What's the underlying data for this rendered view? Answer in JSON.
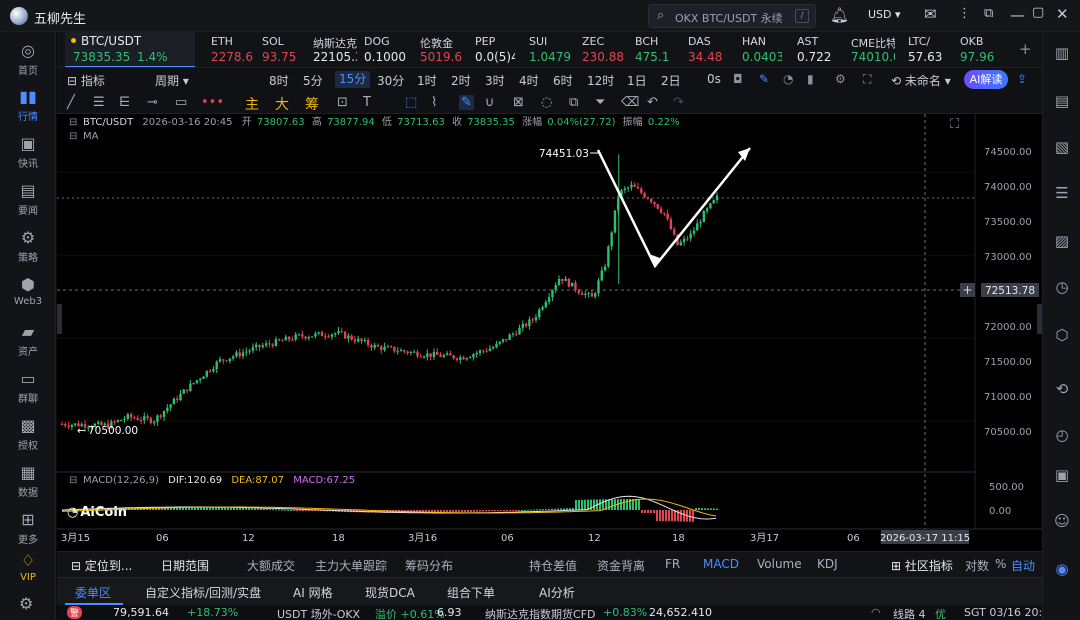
{
  "app": {
    "title": "五柳先生"
  },
  "search": {
    "placeholder": "OKX BTC/USDT 永续",
    "shortcut": "/"
  },
  "header": {
    "currency": "USD"
  },
  "sidebar": {
    "items": [
      {
        "label": "首页",
        "icon": "home-icon"
      },
      {
        "label": "行情",
        "icon": "chart-bars-icon"
      },
      {
        "label": "快讯",
        "icon": "flash-icon"
      },
      {
        "label": "要闻",
        "icon": "news-icon"
      },
      {
        "label": "策略",
        "icon": "robot-icon"
      },
      {
        "label": "Web3",
        "icon": "web3-icon"
      },
      {
        "label": "资产",
        "icon": "wallet-icon"
      },
      {
        "label": "群聊",
        "icon": "chat-icon"
      },
      {
        "label": "授权",
        "icon": "key-icon"
      },
      {
        "label": "数据",
        "icon": "data-icon"
      },
      {
        "label": "更多",
        "icon": "grid-icon"
      },
      {
        "label": "VIP",
        "icon": "vip-icon"
      }
    ]
  },
  "ticker": {
    "active": {
      "name": "BTC/USDT",
      "price": "73835.35",
      "change": "1.4%"
    },
    "items": [
      {
        "name": "ETH",
        "price": "2278.6"
      },
      {
        "name": "SOL",
        "price": "93.75"
      },
      {
        "name": "纳斯达克",
        "price": "22105.3"
      },
      {
        "name": "DOG",
        "price": "0.1000"
      },
      {
        "name": "伦敦金",
        "price": "5019.6"
      },
      {
        "name": "PEP",
        "price": "0.0(5)4"
      },
      {
        "name": "SUI",
        "price": "1.0479"
      },
      {
        "name": "ZEC",
        "price": "230.88"
      },
      {
        "name": "BCH",
        "price": "475.1"
      },
      {
        "name": "DAS",
        "price": "34.48"
      },
      {
        "name": "HAN",
        "price": "0.0403"
      },
      {
        "name": "AST",
        "price": "0.722"
      },
      {
        "name": "CME比特",
        "price": "74010.0"
      },
      {
        "name": "LTC/",
        "price": "57.63"
      },
      {
        "name": "OKB",
        "price": "97.96"
      }
    ]
  },
  "periodbar": {
    "indicator": "指标",
    "period": "周期",
    "periods": [
      "8时",
      "5分",
      "15分",
      "30分",
      "1时",
      "2时",
      "3时",
      "4时",
      "6时",
      "12时",
      "1日",
      "2日"
    ],
    "selected": "15分",
    "countdown": "0s",
    "layout_name": "未命名",
    "ai_button": "AI解读"
  },
  "drawbar": {
    "chips": [
      "主",
      "大",
      "筹"
    ]
  },
  "chart": {
    "info": {
      "symbol": "BTC/USDT",
      "datetime": "2026-03-16 20:45",
      "open_label": "开",
      "open": "73807.63",
      "high_label": "高",
      "high": "73877.94",
      "low_label": "低",
      "low": "73713.63",
      "close_label": "收",
      "close": "73835.35",
      "change_label": "涨幅",
      "change": "0.04%(27.72)",
      "amp_label": "振幅",
      "amp": "0.22%"
    },
    "ma_label": "MA",
    "macd": {
      "label": "MACD(12,26,9)",
      "dif": "DIF:120.69",
      "dea": "DEA:87.07",
      "macd": "MACD:67.25"
    },
    "high_marker": "74451.03",
    "low_marker": "70500.00",
    "crosshair_price": "72513.78",
    "crosshair_time": "2026-03-17 11:15",
    "watermark": "AiCoin",
    "price_ticks": [
      "74500.00",
      "74000.00",
      "73500.00",
      "73000.00",
      "72000.00",
      "71500.00",
      "71000.00",
      "70500.00"
    ],
    "macd_ticks": [
      "500.00",
      "0.00"
    ],
    "time_ticks": [
      "3月15",
      "06",
      "12",
      "18",
      "3月16",
      "06",
      "12",
      "18",
      "3月17",
      "06"
    ],
    "colors": {
      "up": "#2fbf71",
      "down": "#e0454f",
      "dif": "#e6e6e6",
      "dea": "#f0b90b"
    }
  },
  "chart_data": {
    "type": "candlestick",
    "title": "BTC/USDT 15分",
    "series": [
      {
        "name": "BTC/USDT",
        "x": [
          "3月15",
          "06",
          "12",
          "18",
          "3月16",
          "06",
          "12",
          "18"
        ],
        "close": [
          70550,
          70750,
          71650,
          71800,
          71650,
          72100,
          74000,
          73100
        ]
      }
    ],
    "ylim": [
      70300,
      74700
    ],
    "annotations": [
      {
        "text": "74451.03",
        "type": "high"
      },
      {
        "text": "70500.00",
        "type": "low"
      }
    ]
  },
  "bottom": {
    "tabs": [
      "定位到...",
      "日期范围",
      "大额成交",
      "主力大单跟踪",
      "筹码分布",
      "持仓差值",
      "资金背离",
      "FR",
      "MACD",
      "Volume",
      "KDJ",
      "社区指标",
      "对数",
      "%",
      "自动"
    ],
    "subtabs": [
      "委单区",
      "自定义指标/回测/实盘",
      "AI 网格",
      "现货DCA",
      "组合下单",
      "AI分析"
    ],
    "side_label": "筹",
    "side_label2": "爆"
  },
  "status": {
    "item1_name": "警",
    "item1_value": "79,591.64",
    "item1_change": "+18.73%",
    "item2": "USDT 场外-OKX",
    "item2_change": "溢价 +0.61%",
    "item2_value": "6.93",
    "item3": "纳斯达克指数期货CFD",
    "item3_change": "+0.83%",
    "item3_value": "24,652.410",
    "line": "线路 4",
    "line_status": "优",
    "time": "SGT 03/16 20:59:26"
  }
}
